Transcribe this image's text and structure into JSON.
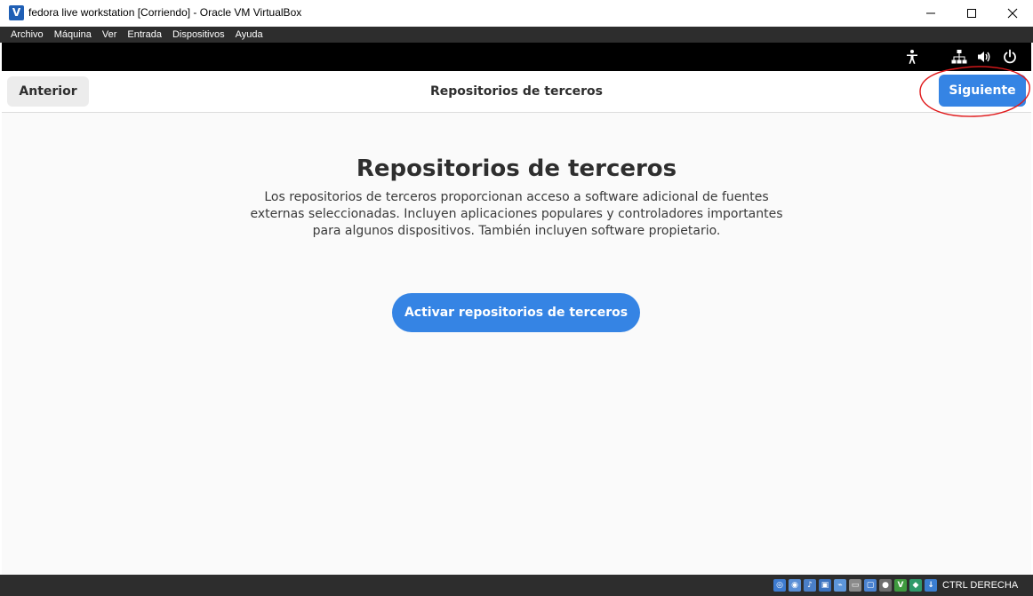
{
  "window": {
    "title": "fedora live workstation [Corriendo] - Oracle VM VirtualBox",
    "minimize": "—",
    "maximize": "☐",
    "close": "✕"
  },
  "menubar": {
    "items": [
      {
        "label": "Archivo"
      },
      {
        "label": "Máquina"
      },
      {
        "label": "Ver"
      },
      {
        "label": "Entrada"
      },
      {
        "label": "Dispositivos"
      },
      {
        "label": "Ayuda"
      }
    ]
  },
  "topbar": {
    "icons": [
      "accessibility-icon",
      "network-icon",
      "volume-icon",
      "power-icon"
    ]
  },
  "header": {
    "previous_label": "Anterior",
    "title": "Repositorios de terceros",
    "next_label": "Siguiente",
    "annotation_color": "#e0191b"
  },
  "main": {
    "title": "Repositorios de terceros",
    "description": "Los repositorios de terceros proporcionan acceso a software adicional de fuentes externas seleccionadas. Incluyen aplicaciones populares y controladores importantes para algunos dispositivos. También incluyen software propietario.",
    "activate_label": "Activar repositorios de terceros"
  },
  "statusbar": {
    "icons": [
      "hard-disk-icon",
      "optical-drive-icon",
      "audio-icon",
      "network-adapter-icon",
      "usb-icon",
      "shared-folders-icon",
      "display-icon",
      "video-capture-icon",
      "virtualization-icon",
      "mouse-integration-icon",
      "keyboard-capture-icon"
    ],
    "host_key": "CTRL DERECHA"
  },
  "colors": {
    "accent": "#3584e4",
    "headerbar": "#ffffff",
    "content_bg": "#fafafa",
    "vbox_bar": "#2d2d2d"
  }
}
